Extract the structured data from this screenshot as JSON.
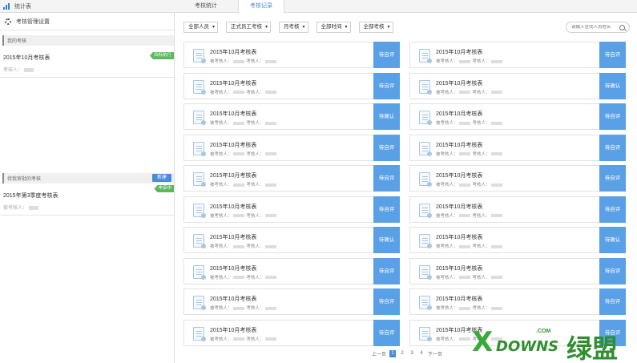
{
  "topbar": {
    "stats_link": "统计表",
    "tabs": [
      {
        "label": "考核统计",
        "active": false
      },
      {
        "label": "考核记录",
        "active": true
      }
    ]
  },
  "sidebar": {
    "header": "考核管理设置",
    "my_section": "我的考核",
    "my_items": [
      {
        "title": "2015年10月考核表",
        "sub": "考核人：",
        "badge": "目标执行"
      }
    ],
    "pending_section": "待我审批的考核",
    "new_button": "新建",
    "pending_items": [
      {
        "title": "2015年第3季度考核表",
        "sub": "被考核人：",
        "badge": "申诉中"
      }
    ]
  },
  "filters": {
    "people": "全部人员",
    "type": "正式员工考核",
    "period": "月考核",
    "time": "全部时间",
    "status": "全部考核",
    "search_placeholder": "请输入查找人员姓名"
  },
  "records": [
    {
      "title": "2015年10月考核表",
      "status": "待自评"
    },
    {
      "title": "2015年10月考核表",
      "status": "待自评"
    },
    {
      "title": "2015年10月考核表",
      "status": "待自评"
    },
    {
      "title": "2015年10月考核表",
      "status": "待确认"
    },
    {
      "title": "2015年10月考核表",
      "status": "待确认"
    },
    {
      "title": "2015年10月考核表",
      "status": "待自评"
    },
    {
      "title": "2015年10月考核表",
      "status": "待自评"
    },
    {
      "title": "2015年10月考核表",
      "status": "待自评"
    },
    {
      "title": "2015年10月考核表",
      "status": "待自评"
    },
    {
      "title": "2015年10月考核表",
      "status": "待自评"
    },
    {
      "title": "2015年10月考核表",
      "status": "待自评"
    },
    {
      "title": "2015年10月考核表",
      "status": "待自评"
    },
    {
      "title": "2015年10月考核表",
      "status": "待确认"
    },
    {
      "title": "2015年10月考核表",
      "status": "待确认"
    },
    {
      "title": "2015年10月考核表",
      "status": "待自评"
    },
    {
      "title": "2015年10月考核表",
      "status": "待自评"
    },
    {
      "title": "2015年10月考核表",
      "status": "待自评"
    },
    {
      "title": "2015年10月考核表",
      "status": "待自评"
    },
    {
      "title": "2015年10月考核表",
      "status": "待自评"
    },
    {
      "title": "2015年10月考核表",
      "status": "待自评"
    }
  ],
  "record_meta": {
    "assessee": "被考核人：",
    "assessor": "考核人："
  },
  "pager": {
    "prev": "上一页",
    "pages": [
      "1",
      "2",
      "3",
      "4"
    ],
    "current": "1",
    "next": "下一页"
  },
  "watermark": {
    "brand": "DOWNS",
    "com": ".COM",
    "cn": "绿盟"
  },
  "colors": {
    "accent": "#5aa0e6",
    "success": "#5cb85c",
    "brand_green": "#2f8f2f"
  }
}
